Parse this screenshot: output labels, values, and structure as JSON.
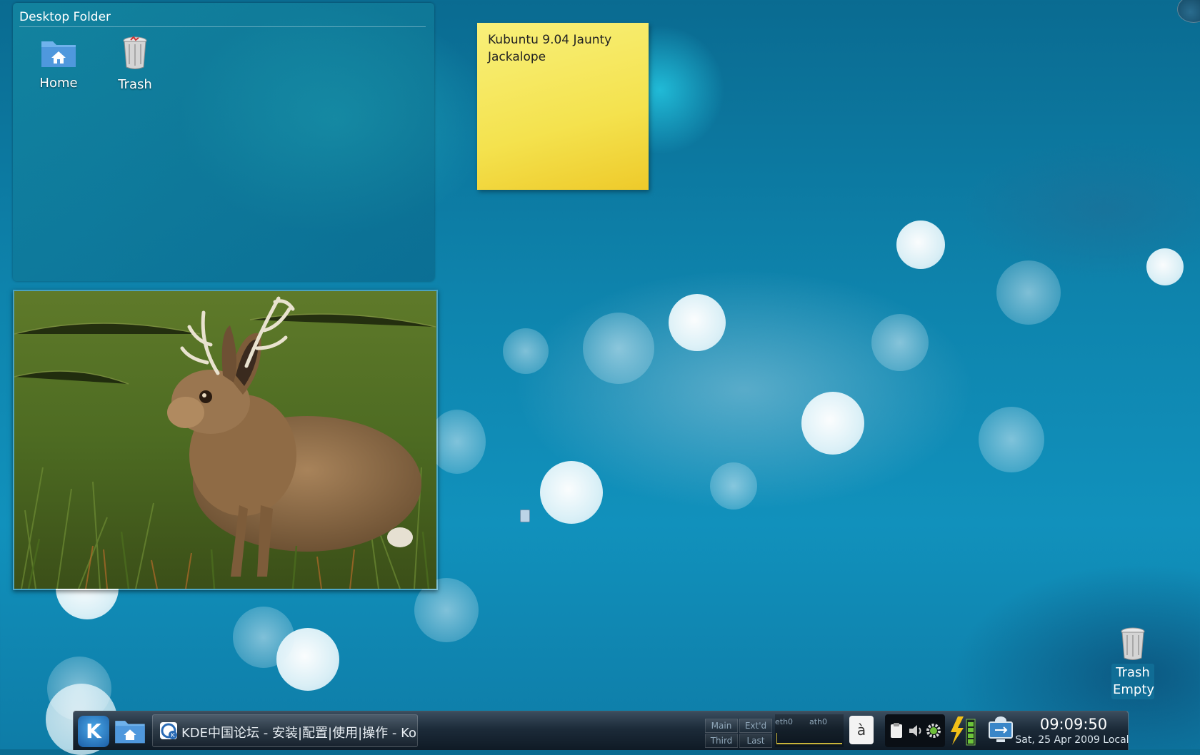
{
  "desktop": {
    "folderview": {
      "title": "Desktop Folder",
      "items": [
        {
          "label": "Home",
          "icon": "home-folder-icon"
        },
        {
          "label": "Trash",
          "icon": "trash-icon"
        }
      ]
    },
    "note": {
      "text": "Kubuntu 9.04 Jaunty Jackalope"
    },
    "photo": {
      "subject": "jackalope-photo"
    },
    "trash_widget": {
      "line1": "Trash",
      "line2": "Empty"
    }
  },
  "panel": {
    "launcher": {
      "label": "K",
      "icon": "kde-menu-icon"
    },
    "home_button": {
      "icon": "home-folder-icon"
    },
    "task": {
      "label": "KDE中国论坛 - 安装|配置|使用|操作 - Kor",
      "icon": "konqueror-icon"
    },
    "pager": {
      "desktops": [
        "Main",
        "Ext'd",
        "Third",
        "Last"
      ]
    },
    "network_monitor": {
      "labels": [
        "eth0",
        "ath0"
      ]
    },
    "keyboard_layout": {
      "label": "à"
    },
    "system_tray": {
      "icons": [
        "clipboard-icon",
        "volume-icon",
        "settings-icon"
      ]
    },
    "battery": {
      "icon": "battery-icon"
    },
    "network": {
      "icon": "network-icon"
    },
    "clock": {
      "time": "09:09:50",
      "date": "Sat, 25 Apr 2009 Local"
    }
  },
  "colors": {
    "background": "#0e84ad",
    "note": "#f4e24e",
    "panel": "#1c2b39"
  }
}
